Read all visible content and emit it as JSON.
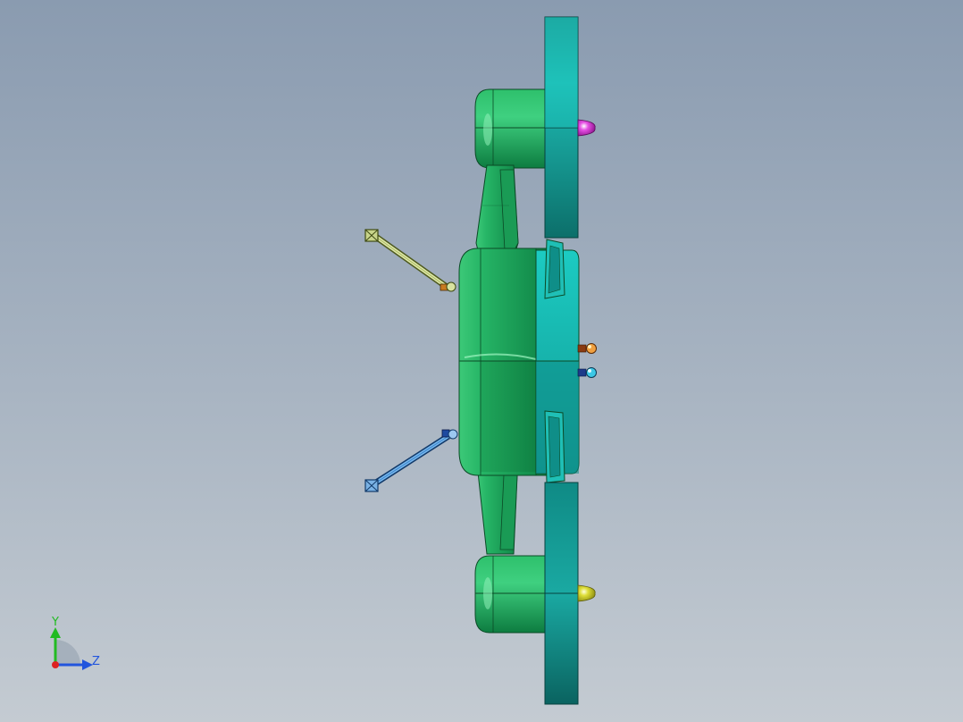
{
  "viewport": {
    "background_top": "#8a9bb0",
    "background_bottom": "#c4cbd2"
  },
  "model": {
    "body_color": "#1fa85c",
    "rotor_color": "#159d96",
    "nose_colors": {
      "top": "#d22ad0",
      "bottom": "#d6d62a"
    },
    "light_colors": [
      "#e08a2a",
      "#22b8d8"
    ]
  },
  "triad": {
    "y_label": "Y",
    "z_label": "Z",
    "y_color": "#22bb22",
    "z_color": "#2255dd",
    "origin_color": "#dd2222"
  }
}
